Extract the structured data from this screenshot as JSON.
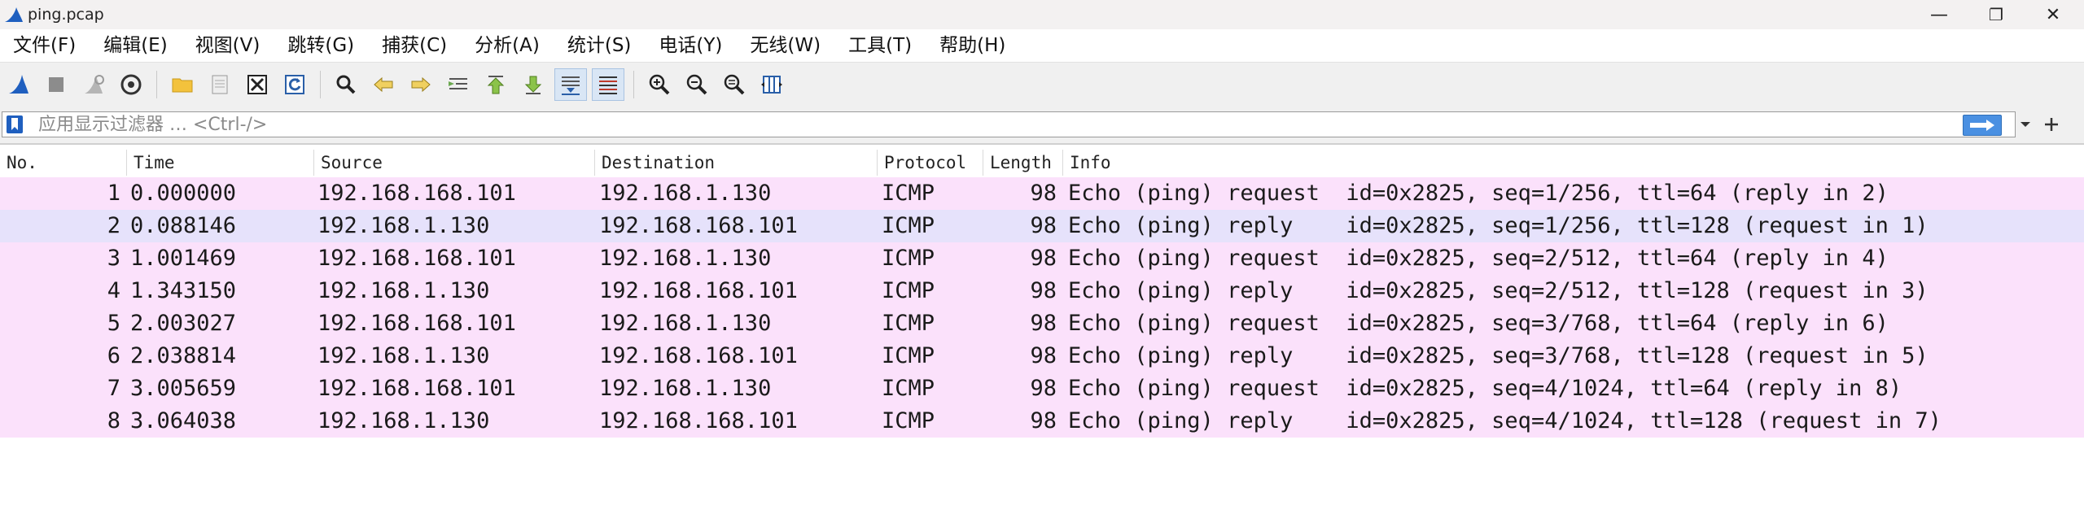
{
  "window": {
    "title": "ping.pcap",
    "minimize": "—",
    "maximize": "❐",
    "close": "✕"
  },
  "menu": [
    "文件(F)",
    "编辑(E)",
    "视图(V)",
    "跳转(G)",
    "捕获(C)",
    "分析(A)",
    "统计(S)",
    "电话(Y)",
    "无线(W)",
    "工具(T)",
    "帮助(H)"
  ],
  "toolbar": {
    "icons": [
      "shark-fin-icon",
      "stop-icon",
      "restart-icon",
      "options-gear-icon",
      "open-folder-icon",
      "file-icon",
      "close-file-icon",
      "reload-icon",
      "find-icon",
      "back-arrow-icon",
      "forward-arrow-icon",
      "goto-packet-icon",
      "first-packet-icon",
      "last-packet-icon",
      "autoscroll-icon",
      "colorize-icon",
      "zoom-in-icon",
      "zoom-out-icon",
      "normal-size-icon",
      "resize-columns-icon"
    ]
  },
  "filter": {
    "placeholder": "应用显示过滤器 … <Ctrl-/>"
  },
  "columns": [
    "No.",
    "Time",
    "Source",
    "Destination",
    "Protocol",
    "Length",
    "Info"
  ],
  "packets": [
    {
      "no": "1",
      "time": "0.000000",
      "source": "192.168.168.101",
      "destination": "192.168.1.130",
      "protocol": "ICMP",
      "length": "98",
      "info": "Echo (ping) request  id=0x2825, seq=1/256, ttl=64 (reply in 2)"
    },
    {
      "no": "2",
      "time": "0.088146",
      "source": "192.168.1.130",
      "destination": "192.168.168.101",
      "protocol": "ICMP",
      "length": "98",
      "info": "Echo (ping) reply    id=0x2825, seq=1/256, ttl=128 (request in 1)"
    },
    {
      "no": "3",
      "time": "1.001469",
      "source": "192.168.168.101",
      "destination": "192.168.1.130",
      "protocol": "ICMP",
      "length": "98",
      "info": "Echo (ping) request  id=0x2825, seq=2/512, ttl=64 (reply in 4)"
    },
    {
      "no": "4",
      "time": "1.343150",
      "source": "192.168.1.130",
      "destination": "192.168.168.101",
      "protocol": "ICMP",
      "length": "98",
      "info": "Echo (ping) reply    id=0x2825, seq=2/512, ttl=128 (request in 3)"
    },
    {
      "no": "5",
      "time": "2.003027",
      "source": "192.168.168.101",
      "destination": "192.168.1.130",
      "protocol": "ICMP",
      "length": "98",
      "info": "Echo (ping) request  id=0x2825, seq=3/768, ttl=64 (reply in 6)"
    },
    {
      "no": "6",
      "time": "2.038814",
      "source": "192.168.1.130",
      "destination": "192.168.168.101",
      "protocol": "ICMP",
      "length": "98",
      "info": "Echo (ping) reply    id=0x2825, seq=3/768, ttl=128 (request in 5)"
    },
    {
      "no": "7",
      "time": "3.005659",
      "source": "192.168.168.101",
      "destination": "192.168.1.130",
      "protocol": "ICMP",
      "length": "98",
      "info": "Echo (ping) request  id=0x2825, seq=4/1024, ttl=64 (reply in 8)"
    },
    {
      "no": "8",
      "time": "3.064038",
      "source": "192.168.1.130",
      "destination": "192.168.168.101",
      "protocol": "ICMP",
      "length": "98",
      "info": "Echo (ping) reply    id=0x2825, seq=4/1024, ttl=128 (request in 7)"
    }
  ],
  "colors": {
    "icmp_row": "#fbe1fb",
    "selected_row": "#e6e2fb",
    "accent": "#1f5fbf"
  }
}
